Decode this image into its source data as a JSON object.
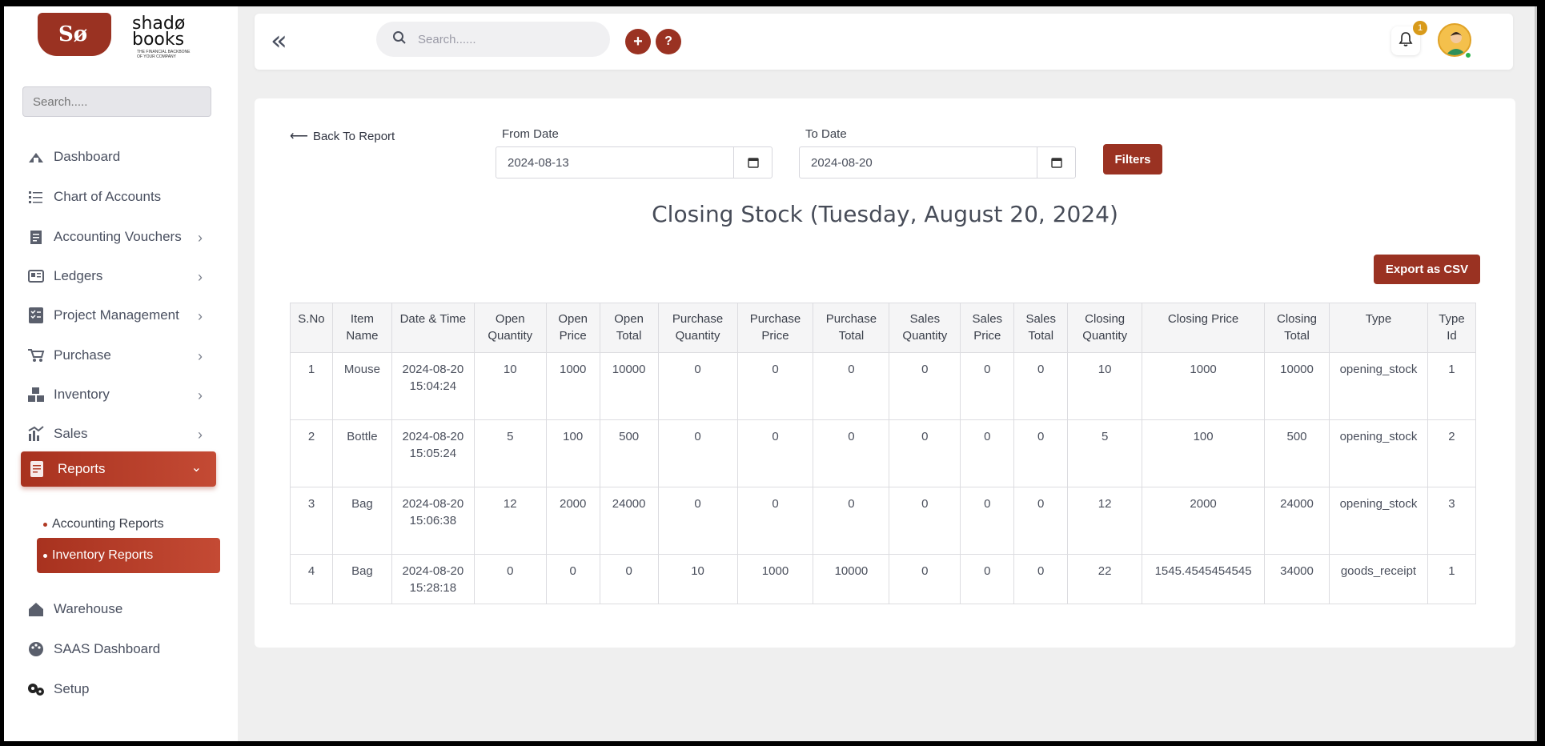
{
  "brand": {
    "logo_mark": "Sø",
    "name_line1": "shadø",
    "name_line2": "books",
    "tagline": "THE FINANCIAL BACKBONE OF YOUR COMPANY"
  },
  "sidebar": {
    "search_placeholder": "Search.....",
    "items": [
      {
        "label": "Dashboard",
        "icon": "dashboard-icon"
      },
      {
        "label": "Chart of Accounts",
        "icon": "list-icon"
      },
      {
        "label": "Accounting Vouchers",
        "icon": "voucher-icon"
      },
      {
        "label": "Ledgers",
        "icon": "ledger-icon"
      },
      {
        "label": "Project Management",
        "icon": "checklist-icon"
      },
      {
        "label": "Purchase",
        "icon": "cart-icon"
      },
      {
        "label": "Inventory",
        "icon": "boxes-icon"
      },
      {
        "label": "Sales",
        "icon": "sales-chart-icon"
      },
      {
        "label": "Reports",
        "icon": "report-icon"
      },
      {
        "label": "Warehouse",
        "icon": "home-icon"
      },
      {
        "label": "SAAS Dashboard",
        "icon": "palette-icon"
      },
      {
        "label": "Setup",
        "icon": "gears-icon"
      }
    ],
    "reports_sub": [
      {
        "label": "Accounting Reports"
      },
      {
        "label": "Inventory Reports"
      }
    ]
  },
  "topbar": {
    "search_placeholder": "Search......",
    "add_label": "+",
    "help_label": "?",
    "notification_count": "1"
  },
  "report": {
    "back_label": "Back To Report",
    "from_label": "From Date",
    "from_value": "2024-08-13",
    "to_label": "To Date",
    "to_value": "2024-08-20",
    "filters_label": "Filters",
    "title": "Closing Stock (Tuesday, August 20, 2024)",
    "export_label": "Export as CSV",
    "columns": [
      "S.No",
      "Item Name",
      "Date & Time",
      "Open Quantity",
      "Open Price",
      "Open Total",
      "Purchase Quantity",
      "Purchase Price",
      "Purchase Total",
      "Sales Quantity",
      "Sales Price",
      "Sales Total",
      "Closing Quantity",
      "Closing Price",
      "Closing Total",
      "Type",
      "Type Id"
    ],
    "rows": [
      [
        "1",
        "Mouse",
        "2024-08-20 15:04:24",
        "10",
        "1000",
        "10000",
        "0",
        "0",
        "0",
        "0",
        "0",
        "0",
        "10",
        "1000",
        "10000",
        "opening_stock",
        "1"
      ],
      [
        "2",
        "Bottle",
        "2024-08-20 15:05:24",
        "5",
        "100",
        "500",
        "0",
        "0",
        "0",
        "0",
        "0",
        "0",
        "5",
        "100",
        "500",
        "opening_stock",
        "2"
      ],
      [
        "3",
        "Bag",
        "2024-08-20 15:06:38",
        "12",
        "2000",
        "24000",
        "0",
        "0",
        "0",
        "0",
        "0",
        "0",
        "12",
        "2000",
        "24000",
        "opening_stock",
        "3"
      ],
      [
        "4",
        "Bag",
        "2024-08-20 15:28:18",
        "0",
        "0",
        "0",
        "10",
        "1000",
        "10000",
        "0",
        "0",
        "0",
        "22",
        "1545.4545454545",
        "34000",
        "goods_receipt",
        "1"
      ]
    ]
  },
  "colors": {
    "accent": "#9a3222",
    "accent_light": "#c44a34",
    "badge": "#d89a1a"
  }
}
